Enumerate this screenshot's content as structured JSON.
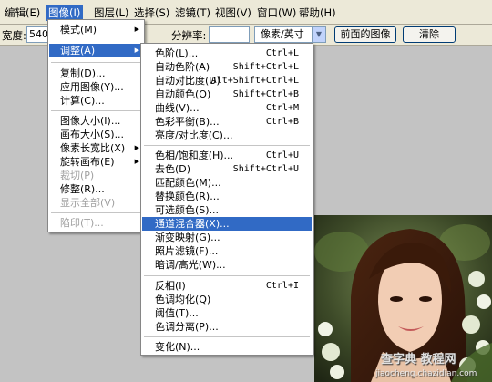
{
  "menubar": [
    {
      "label": "编辑(E)"
    },
    {
      "label": "图像(I)"
    },
    {
      "label": "图层(L)"
    },
    {
      "label": "选择(S)"
    },
    {
      "label": "滤镜(T)"
    },
    {
      "label": "视图(V)"
    },
    {
      "label": "窗口(W)"
    },
    {
      "label": "帮助(H)"
    }
  ],
  "options": {
    "width_label": "宽度:",
    "width_value": "540",
    "resolution_label": "分辨率:",
    "resolution_value": "",
    "unit_select": "像素/英寸",
    "front_image_button": "前面的图像",
    "clear_button": "清除"
  },
  "image_menu": [
    {
      "label": "模式(M)"
    },
    {
      "label": "调整(A)"
    },
    {
      "label": "复制(D)..."
    },
    {
      "label": "应用图像(Y)..."
    },
    {
      "label": "计算(C)..."
    },
    {
      "label": "图像大小(I)..."
    },
    {
      "label": "画布大小(S)..."
    },
    {
      "label": "像素长宽比(X)"
    },
    {
      "label": "旋转画布(E)"
    },
    {
      "label": "裁切(P)"
    },
    {
      "label": "修整(R)..."
    },
    {
      "label": "显示全部(V)"
    },
    {
      "label": "陷印(T)..."
    }
  ],
  "adjust_menu": [
    {
      "label": "色阶(L)...",
      "shortcut": "Ctrl+L"
    },
    {
      "label": "自动色阶(A)",
      "shortcut": "Shift+Ctrl+L"
    },
    {
      "label": "自动对比度(U)",
      "shortcut": "Alt+Shift+Ctrl+L"
    },
    {
      "label": "自动颜色(O)",
      "shortcut": "Shift+Ctrl+B"
    },
    {
      "label": "曲线(V)...",
      "shortcut": "Ctrl+M"
    },
    {
      "label": "色彩平衡(B)...",
      "shortcut": "Ctrl+B"
    },
    {
      "label": "亮度/对比度(C)...",
      "shortcut": ""
    },
    {
      "label": "色相/饱和度(H)...",
      "shortcut": "Ctrl+U"
    },
    {
      "label": "去色(D)",
      "shortcut": "Shift+Ctrl+U"
    },
    {
      "label": "匹配颜色(M)...",
      "shortcut": ""
    },
    {
      "label": "替换颜色(R)...",
      "shortcut": ""
    },
    {
      "label": "可选颜色(S)...",
      "shortcut": ""
    },
    {
      "label": "通道混合器(X)...",
      "shortcut": ""
    },
    {
      "label": "渐变映射(G)...",
      "shortcut": ""
    },
    {
      "label": "照片滤镜(F)...",
      "shortcut": ""
    },
    {
      "label": "暗调/高光(W)...",
      "shortcut": ""
    },
    {
      "label": "反相(I)",
      "shortcut": "Ctrl+I"
    },
    {
      "label": "色调均化(Q)",
      "shortcut": ""
    },
    {
      "label": "阈值(T)...",
      "shortcut": ""
    },
    {
      "label": "色调分离(P)...",
      "shortcut": ""
    },
    {
      "label": "变化(N)...",
      "shortcut": ""
    }
  ],
  "watermark": {
    "line1": "查字典 教程网",
    "line2": "jiaocheng.chazidian.com"
  },
  "colors": {
    "highlight": "#316ac5",
    "workspace": "#c3c3c3",
    "menubar": "#ece9d8"
  }
}
